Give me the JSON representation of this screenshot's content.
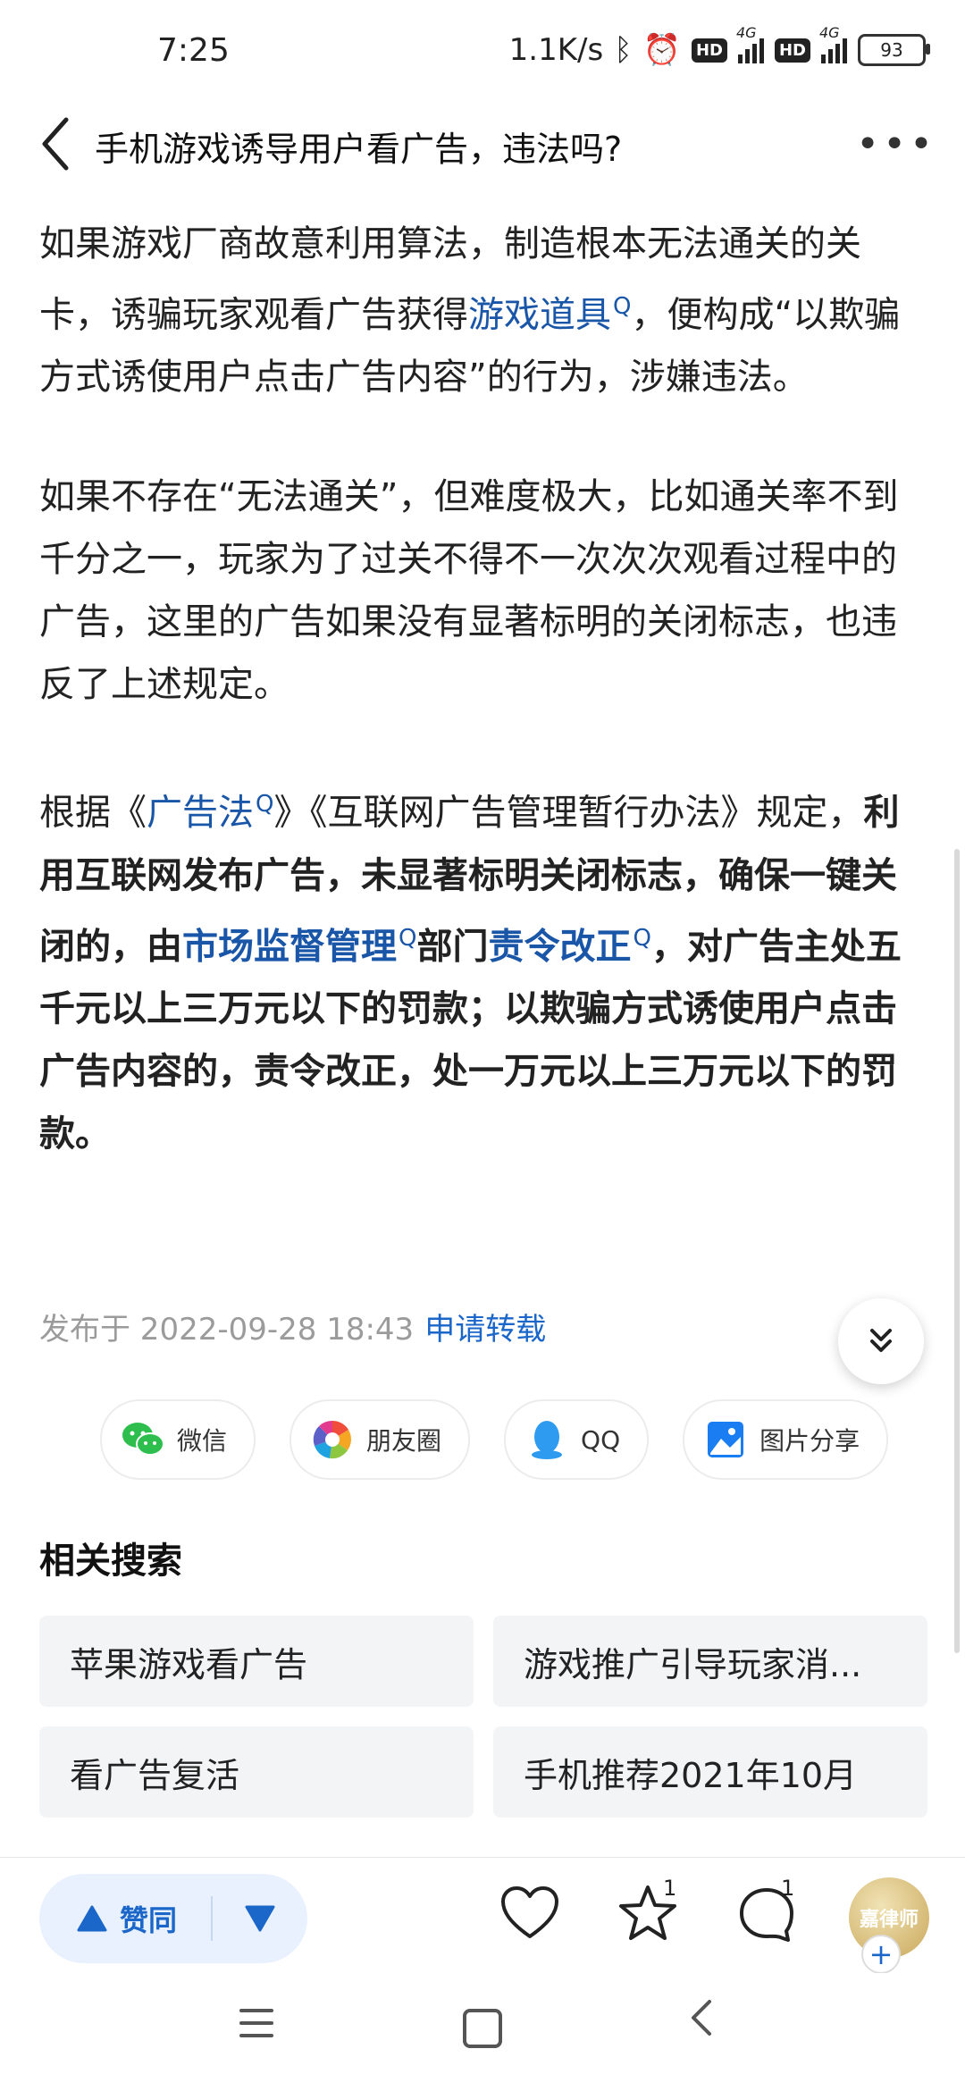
{
  "status_bar": {
    "time": "7:25",
    "net_speed": "1.1K/s",
    "hd1": "HD",
    "net1": "4G",
    "hd2": "HD",
    "net2": "4G",
    "battery": "93"
  },
  "header": {
    "title": "手机游戏诱导用户看广告，违法吗?"
  },
  "article": {
    "p1_a": "如果游戏厂商故意利用算法，制造根本无法通关的关卡，诱骗玩家观看广告获得",
    "p1_link": "游戏道具",
    "p1_b": "，便构成“以欺骗方式诱使用户点击广告内容”的行为，涉嫌违法。",
    "p2": "如果不存在“无法通关”，但难度极大，比如通关率不到千分之一，玩家为了过关不得不一次次次观看过程中的广告，这里的广告如果没有显著标明的关闭标志，也违反了上述规定。",
    "p3_a": "根据《",
    "p3_link1": "广告法",
    "p3_b": "》《互联网广告管理暂行办法》规定，",
    "p3_bold1": "利用互联网发布广告，未显著标明关闭标志，确保一键关闭的，由",
    "p3_link2": "市场监督管理",
    "p3_bold2": "部门",
    "p3_link3": "责令改正",
    "p3_bold3": "，对广告主处五千元以上三万元以下的罚款；以欺骗方式诱使用户点击广告内容的，责令改正，处一万元以上三万元以下的罚款。"
  },
  "meta": {
    "published": "发布于 2022-09-28 18:43",
    "reprint": "申请转载"
  },
  "share": [
    {
      "label": "微信",
      "icon": "wechat-icon"
    },
    {
      "label": "朋友圈",
      "icon": "moments-icon"
    },
    {
      "label": "QQ",
      "icon": "qq-icon"
    },
    {
      "label": "图片分享",
      "icon": "image-share-icon"
    }
  ],
  "related": {
    "title": "相关搜索",
    "items": [
      "苹果游戏看广告",
      "游戏推广引导玩家消...",
      "看广告复活",
      "手机推荐2021年10月"
    ]
  },
  "bottom_bar": {
    "agree_label": "赞同",
    "favorite_count": "1",
    "comment_count": "1",
    "avatar_text": "嘉律师"
  },
  "colors": {
    "link": "#1a56a8",
    "accent": "#1a66c9",
    "vote_bg": "#e8f1fd"
  }
}
